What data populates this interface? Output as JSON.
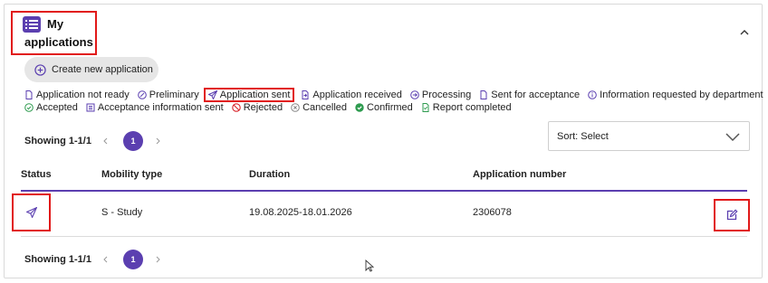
{
  "header": {
    "title_line1": "My",
    "title_line2": "applications"
  },
  "create_button_label": "Create new application",
  "legend": {
    "row1": [
      {
        "label": "Application not ready",
        "icon": "document-icon"
      },
      {
        "label": "Preliminary",
        "icon": "pencil-circle-icon"
      },
      {
        "label": "Application sent",
        "icon": "paper-plane-icon"
      },
      {
        "label": "Application received",
        "icon": "document-arrow-icon"
      },
      {
        "label": "Processing",
        "icon": "arrow-circle-icon"
      },
      {
        "label": "Sent for acceptance",
        "icon": "document-icon"
      },
      {
        "label": "Information requested by department",
        "icon": "info-circle-icon"
      }
    ],
    "row2": [
      {
        "label": "Accepted",
        "icon": "check-circle-outline-icon"
      },
      {
        "label": "Acceptance information sent",
        "icon": "list-box-icon"
      },
      {
        "label": "Rejected",
        "icon": "prohibited-icon"
      },
      {
        "label": "Cancelled",
        "icon": "x-circle-icon"
      },
      {
        "label": "Confirmed",
        "icon": "check-circle-filled-icon"
      },
      {
        "label": "Report completed",
        "icon": "document-check-icon"
      }
    ]
  },
  "pager_top": {
    "showing": "Showing 1-1/1",
    "page": "1"
  },
  "pager_bottom": {
    "showing": "Showing 1-1/1",
    "page": "1"
  },
  "sort": {
    "label": "Sort: Select"
  },
  "table": {
    "headers": [
      "Status",
      "Mobility type",
      "Duration",
      "Application number"
    ],
    "rows": [
      {
        "status_icon": "paper-plane-icon",
        "mobility_type": "S - Study",
        "duration": "19.08.2025-18.01.2026",
        "application_number": "2306078"
      }
    ]
  },
  "colors": {
    "accent": "#5b3fb0",
    "highlight": "#e11919",
    "green": "#2e9b4f"
  }
}
